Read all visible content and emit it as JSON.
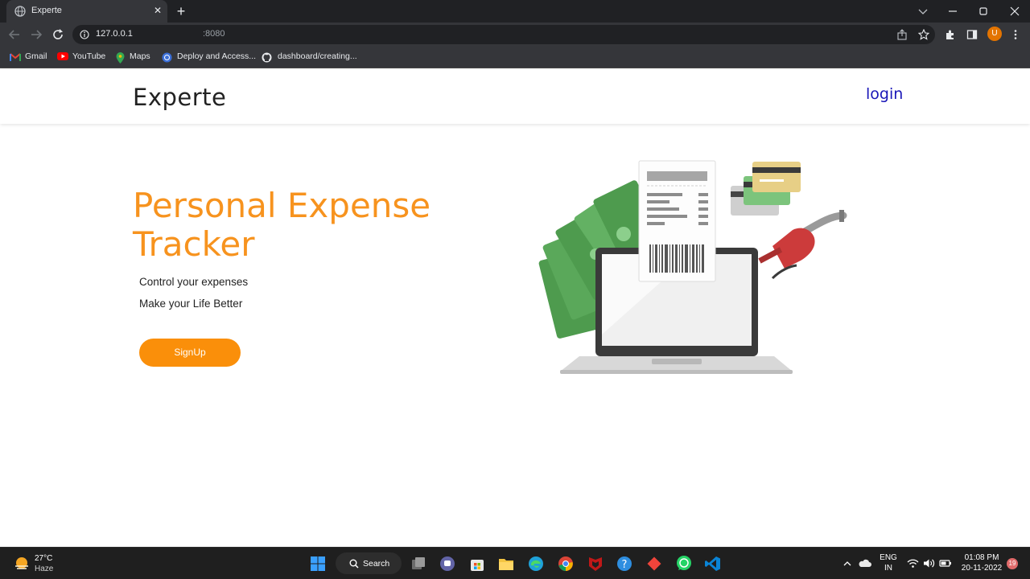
{
  "browser": {
    "tab_title": "Experte",
    "url_host": "127.0.0.1",
    "url_port": ":8080",
    "profile_initial": "U",
    "bookmarks": [
      {
        "label": "Gmail",
        "icon": "gmail-icon"
      },
      {
        "label": "YouTube",
        "icon": "youtube-icon"
      },
      {
        "label": "Maps",
        "icon": "maps-icon"
      },
      {
        "label": "Deploy and Access...",
        "icon": "globe-icon"
      },
      {
        "label": "dashboard/creating...",
        "icon": "github-icon"
      }
    ]
  },
  "page": {
    "brand": "Experte",
    "login_link": "login",
    "hero_title": "Personal Expense Tracker",
    "hero_lines": [
      "Control your expenses",
      "Make your Life Better"
    ],
    "signup_button": "SignUp",
    "colors": {
      "accent": "#f7931e",
      "login": "#1a17b8",
      "button": "#fa8f0a"
    }
  },
  "taskbar": {
    "weather_temp": "27°C",
    "weather_desc": "Haze",
    "search_label": "Search",
    "language": "ENG",
    "region": "IN",
    "time": "01:08 PM",
    "date": "20-11-2022",
    "notification_count": "19"
  }
}
